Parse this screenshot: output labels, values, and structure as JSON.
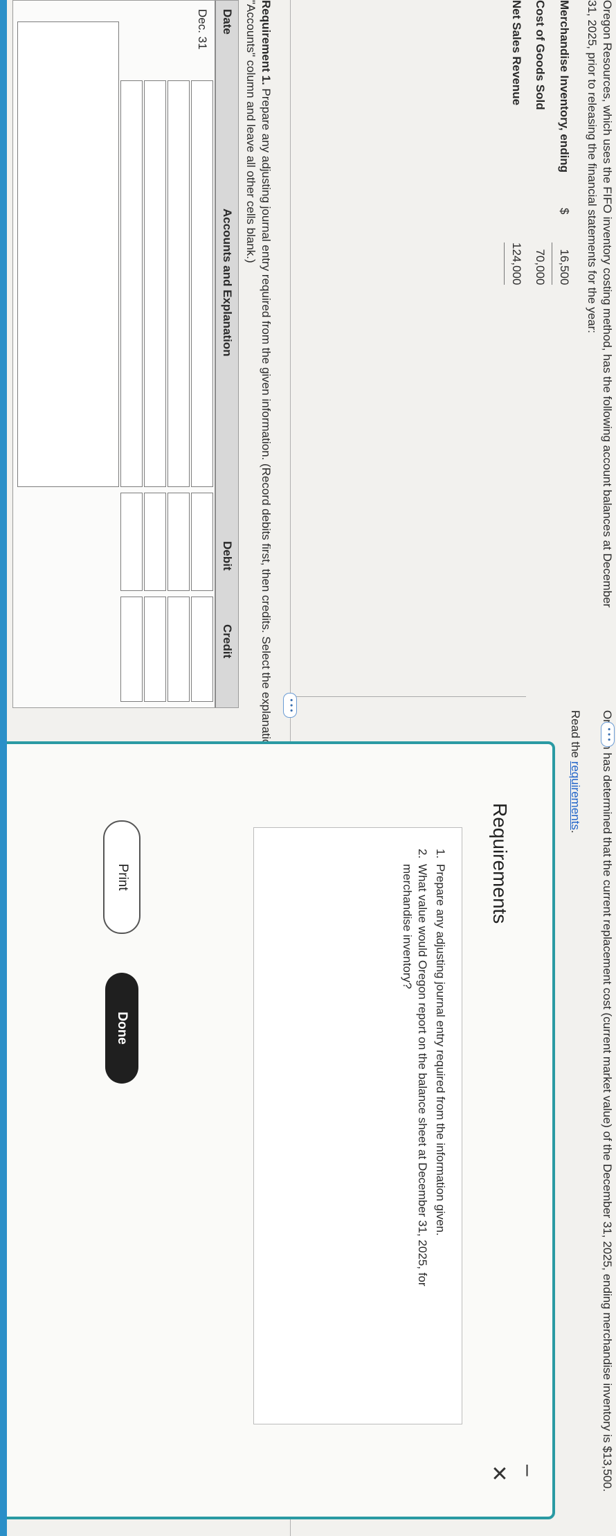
{
  "intro_text": "Oregon Resources, which uses the FIFO inventory costing method, has the following account balances at December 31, 2025, prior to releasing the financial statements for the year:",
  "balances": [
    {
      "name": "Merchandise Inventory, ending",
      "currency": "$",
      "amount": "16,500"
    },
    {
      "name": "Cost of Goods Sold",
      "currency": "",
      "amount": "70,000"
    },
    {
      "name": "Net Sales Revenue",
      "currency": "",
      "amount": "124,000"
    }
  ],
  "right_text": "Oregon has determined that the current replacement cost (current market value) of the December 31, 2025, ending merchandise inventory is $13,500.",
  "read_prefix": "Read the ",
  "read_link": "requirements",
  "read_suffix": ".",
  "dots_label": "• • •",
  "requirement1": {
    "label": "Requirement 1.",
    "text": " Prepare any adjusting journal entry required from the given information. (Record debits first, then credits. Select the explanation on the last line of the journal entry. For situations that do not require an entry, make sure to select \"No entry required\" in the first cell in the \"Accounts\" column and leave all other cells blank.)"
  },
  "journal": {
    "headers": {
      "date": "Date",
      "accounts": "Accounts and Explanation",
      "debit": "Debit",
      "credit": "Credit"
    },
    "date_value": "Dec. 31"
  },
  "modal": {
    "title": "Requirements",
    "minimize": "–",
    "close": "✕",
    "items": [
      {
        "num": "1.",
        "text": "Prepare any adjusting journal entry required from the information given."
      },
      {
        "num": "2.",
        "text": "What value would Oregon report on the balance sheet at December 31, 2025, for merchandise inventory?"
      }
    ],
    "print_label": "Print",
    "done_label": "Done"
  },
  "colors": {
    "accent": "#2a9aa3",
    "link": "#1f63c9",
    "done_bg": "#1f1f1f"
  }
}
